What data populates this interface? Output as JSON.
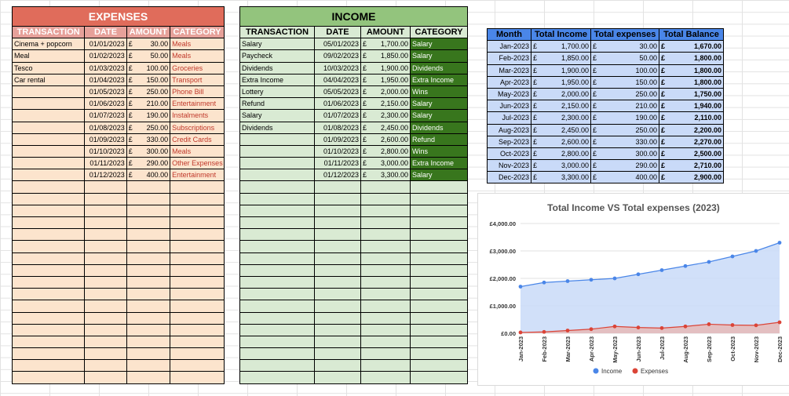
{
  "expenses": {
    "title": "EXPENSES",
    "headers": [
      "TRANSACTION",
      "DATE",
      "AMOUNT",
      "CATEGORY"
    ],
    "currency": "£",
    "rows": [
      {
        "transaction": "Cinema + popcorn",
        "date": "01/01/2023",
        "amount": "30.00",
        "category": "Meals"
      },
      {
        "transaction": "Meal",
        "date": "01/02/2023",
        "amount": "50.00",
        "category": "Meals"
      },
      {
        "transaction": "Tesco",
        "date": "01/03/2023",
        "amount": "100.00",
        "category": "Groceries"
      },
      {
        "transaction": "Car rental",
        "date": "01/04/2023",
        "amount": "150.00",
        "category": "Transport"
      },
      {
        "transaction": "",
        "date": "01/05/2023",
        "amount": "250.00",
        "category": "Phone Bill"
      },
      {
        "transaction": "",
        "date": "01/06/2023",
        "amount": "210.00",
        "category": "Entertainment"
      },
      {
        "transaction": "",
        "date": "01/07/2023",
        "amount": "190.00",
        "category": "Instalments"
      },
      {
        "transaction": "",
        "date": "01/08/2023",
        "amount": "250.00",
        "category": "Subscriptions"
      },
      {
        "transaction": "",
        "date": "01/09/2023",
        "amount": "330.00",
        "category": "Credit Cards"
      },
      {
        "transaction": "",
        "date": "01/10/2023",
        "amount": "300.00",
        "category": "Meals"
      },
      {
        "transaction": "",
        "date": "01/11/2023",
        "amount": "290.00",
        "category": "Other Expenses"
      },
      {
        "transaction": "",
        "date": "01/12/2023",
        "amount": "400.00",
        "category": "Entertainment"
      }
    ]
  },
  "income": {
    "title": "INCOME",
    "headers": [
      "TRANSACTION",
      "DATE",
      "AMOUNT",
      "CATEGORY"
    ],
    "currency": "£",
    "rows": [
      {
        "transaction": "Salary",
        "date": "05/01/2023",
        "amount": "1,700.00",
        "category": "Salary"
      },
      {
        "transaction": "Paycheck",
        "date": "09/02/2023",
        "amount": "1,850.00",
        "category": "Salary"
      },
      {
        "transaction": "Dividends",
        "date": "10/03/2023",
        "amount": "1,900.00",
        "category": "Dividends"
      },
      {
        "transaction": "Extra Income",
        "date": "04/04/2023",
        "amount": "1,950.00",
        "category": "Extra Income"
      },
      {
        "transaction": "Lottery",
        "date": "05/05/2023",
        "amount": "2,000.00",
        "category": "Wins"
      },
      {
        "transaction": "Refund",
        "date": "01/06/2023",
        "amount": "2,150.00",
        "category": "Salary"
      },
      {
        "transaction": "Salary",
        "date": "01/07/2023",
        "amount": "2,300.00",
        "category": "Salary"
      },
      {
        "transaction": "Dividends",
        "date": "01/08/2023",
        "amount": "2,450.00",
        "category": "Dividends"
      },
      {
        "transaction": "",
        "date": "01/09/2023",
        "amount": "2,600.00",
        "category": "Refund"
      },
      {
        "transaction": "",
        "date": "01/10/2023",
        "amount": "2,800.00",
        "category": "Wins"
      },
      {
        "transaction": "",
        "date": "01/11/2023",
        "amount": "3,000.00",
        "category": "Extra Income"
      },
      {
        "transaction": "",
        "date": "01/12/2023",
        "amount": "3,300.00",
        "category": "Salary"
      }
    ]
  },
  "balance": {
    "headers": [
      "Month",
      "Total Income",
      "Total expenses",
      "Total Balance"
    ],
    "currency": "£",
    "rows": [
      {
        "month": "Jan-2023",
        "income": "1,700.00",
        "expenses": "30.00",
        "balance": "1,670.00"
      },
      {
        "month": "Feb-2023",
        "income": "1,850.00",
        "expenses": "50.00",
        "balance": "1,800.00"
      },
      {
        "month": "Mar-2023",
        "income": "1,900.00",
        "expenses": "100.00",
        "balance": "1,800.00"
      },
      {
        "month": "Apr-2023",
        "income": "1,950.00",
        "expenses": "150.00",
        "balance": "1,800.00"
      },
      {
        "month": "May-2023",
        "income": "2,000.00",
        "expenses": "250.00",
        "balance": "1,750.00"
      },
      {
        "month": "Jun-2023",
        "income": "2,150.00",
        "expenses": "210.00",
        "balance": "1,940.00"
      },
      {
        "month": "Jul-2023",
        "income": "2,300.00",
        "expenses": "190.00",
        "balance": "2,110.00"
      },
      {
        "month": "Aug-2023",
        "income": "2,450.00",
        "expenses": "250.00",
        "balance": "2,200.00"
      },
      {
        "month": "Sep-2023",
        "income": "2,600.00",
        "expenses": "330.00",
        "balance": "2,270.00"
      },
      {
        "month": "Oct-2023",
        "income": "2,800.00",
        "expenses": "300.00",
        "balance": "2,500.00"
      },
      {
        "month": "Nov-2023",
        "income": "3,000.00",
        "expenses": "290.00",
        "balance": "2,710.00"
      },
      {
        "month": "Dec-2023",
        "income": "3,300.00",
        "expenses": "400.00",
        "balance": "2,900.00"
      }
    ]
  },
  "chart_data": {
    "type": "area",
    "title": "Total Income VS Total expenses (2023)",
    "categories": [
      "Jan-2023",
      "Feb-2023",
      "Mar-2023",
      "Apr-2023",
      "May-2023",
      "Jun-2023",
      "Jul-2023",
      "Aug-2023",
      "Sep-2023",
      "Oct-2023",
      "Nov-2023",
      "Dec-2023"
    ],
    "series": [
      {
        "name": "Income",
        "color": "#4a86e8",
        "fill": "#c9daf8",
        "values": [
          1700,
          1850,
          1900,
          1950,
          2000,
          2150,
          2300,
          2450,
          2600,
          2800,
          3000,
          3300
        ]
      },
      {
        "name": "Expenses",
        "color": "#db4437",
        "fill": "#e6b8b7",
        "values": [
          30,
          50,
          100,
          150,
          250,
          210,
          190,
          250,
          330,
          300,
          290,
          400
        ]
      }
    ],
    "ylim": [
      0,
      4000
    ],
    "yticks": [
      0,
      1000,
      2000,
      3000,
      4000
    ],
    "ytick_labels": [
      "£0.00",
      "£1,000.00",
      "£2,000.00",
      "£3,000.00",
      "£4,000.00"
    ],
    "legend": "bottom",
    "grid": true
  }
}
